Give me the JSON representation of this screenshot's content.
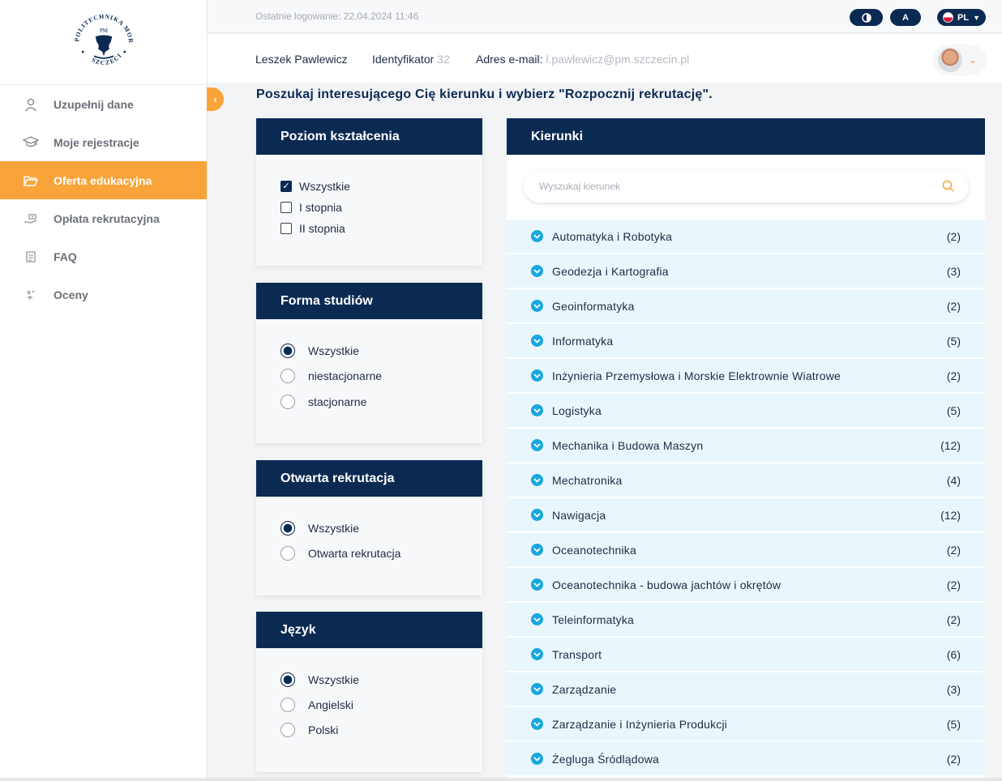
{
  "logo": {
    "ring_text": "POLITECHNIKA MORSKA",
    "bottom_text": "SZCZECIN",
    "monogram": "PM"
  },
  "sidebar": {
    "items": [
      {
        "label": "Uzupełnij dane",
        "icon": "user-icon",
        "active": false
      },
      {
        "label": "Moje rejestracje",
        "icon": "graduation-cap-icon",
        "active": false
      },
      {
        "label": "Oferta edukacyjna",
        "icon": "folder-open-icon",
        "active": true
      },
      {
        "label": "Opłata rekrutacyjna",
        "icon": "hand-money-icon",
        "active": false
      },
      {
        "label": "FAQ",
        "icon": "document-icon",
        "active": false
      },
      {
        "label": "Oceny",
        "icon": "grades-icon",
        "active": false
      }
    ]
  },
  "topbar": {
    "last_login_label": "Ostatnie logowanie:",
    "last_login_value": "22.04.2024 11:46",
    "font_button": "A",
    "lang": "PL"
  },
  "user": {
    "name": "Leszek Pawlewicz",
    "id_label": "Identyfikator",
    "id_value": "32",
    "email_label": "Adres e-mail:",
    "email_value": "l.pawlewicz@pm.szczecin.pl"
  },
  "main": {
    "heading": "Poszukaj interesującego Cię kierunku i wybierz \"Rozpocznij rekrutację\"."
  },
  "filters": {
    "level": {
      "title": "Poziom kształcenia",
      "options": [
        {
          "label": "Wszystkie",
          "checked": true
        },
        {
          "label": "I stopnia",
          "checked": false
        },
        {
          "label": "II stopnia",
          "checked": false
        }
      ]
    },
    "form": {
      "title": "Forma studiów",
      "options": [
        {
          "label": "Wszystkie",
          "checked": true
        },
        {
          "label": "niestacjonarne",
          "checked": false
        },
        {
          "label": "stacjonarne",
          "checked": false
        }
      ]
    },
    "open": {
      "title": "Otwarta rekrutacja",
      "options": [
        {
          "label": "Wszystkie",
          "checked": true
        },
        {
          "label": "Otwarta rekrutacja",
          "checked": false
        }
      ]
    },
    "language": {
      "title": "Język",
      "options": [
        {
          "label": "Wszystkie",
          "checked": true
        },
        {
          "label": "Angielski",
          "checked": false
        },
        {
          "label": "Polski",
          "checked": false
        }
      ]
    }
  },
  "programs": {
    "title": "Kierunki",
    "search_placeholder": "Wyszukaj kierunek",
    "items": [
      {
        "name": "Automatyka i Robotyka",
        "count": "(2)"
      },
      {
        "name": "Geodezja i Kartografia",
        "count": "(3)"
      },
      {
        "name": "Geoinformatyka",
        "count": "(2)"
      },
      {
        "name": "Informatyka",
        "count": "(5)"
      },
      {
        "name": "Inżynieria Przemysłowa i Morskie Elektrownie Wiatrowe",
        "count": "(2)"
      },
      {
        "name": "Logistyka",
        "count": "(5)"
      },
      {
        "name": "Mechanika i Budowa Maszyn",
        "count": "(12)"
      },
      {
        "name": "Mechatronika",
        "count": "(4)"
      },
      {
        "name": "Nawigacja",
        "count": "(12)"
      },
      {
        "name": "Oceanotechnika",
        "count": "(2)"
      },
      {
        "name": "Oceanotechnika - budowa jachtów i okrętów",
        "count": "(2)"
      },
      {
        "name": "Teleinformatyka",
        "count": "(2)"
      },
      {
        "name": "Transport",
        "count": "(6)"
      },
      {
        "name": "Zarządzanie",
        "count": "(3)"
      },
      {
        "name": "Zarządzanie i Inżynieria Produkcji",
        "count": "(5)"
      },
      {
        "name": "Żegluga Śródlądowa",
        "count": "(2)"
      }
    ]
  },
  "colors": {
    "navy": "#0b2a52",
    "accent": "#f8a43a",
    "row_bg": "#e9f7fc",
    "row_icon": "#18a7df"
  }
}
